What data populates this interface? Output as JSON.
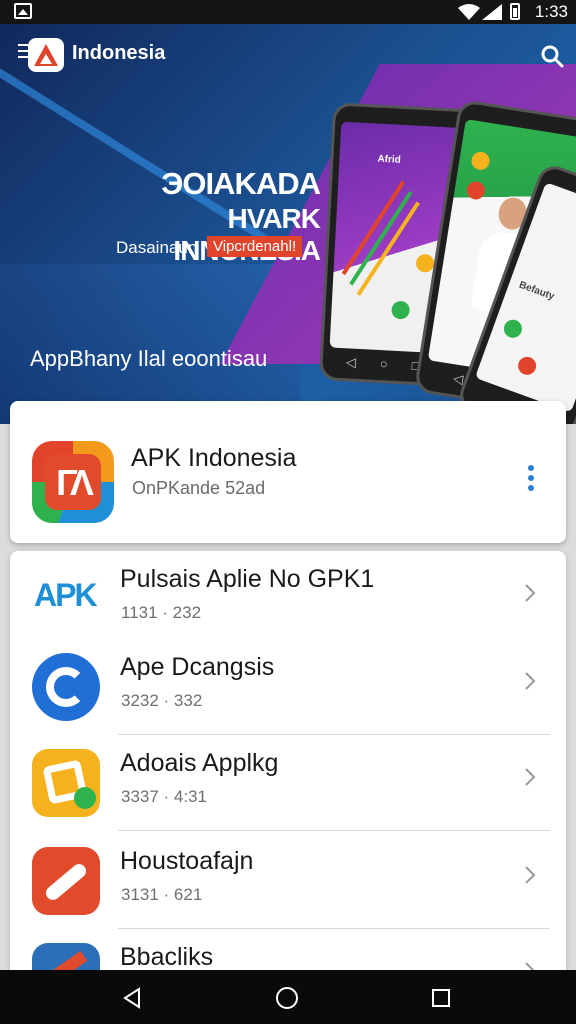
{
  "status": {
    "time": "1:33"
  },
  "header": {
    "title": "Indonesia"
  },
  "banner": {
    "heading_1": "ЭOIAKADA",
    "heading_2": "HVARK INNONESIA",
    "subtitle": "Dasainaun",
    "badge": "Vipcrdenahl!",
    "tagline": "AppBhany Ilal eoontisau",
    "phone_label": "Afrid",
    "phone_card": "Befauty"
  },
  "featured_app": {
    "name": "APK Indonesia",
    "subtitle": "OnPKande 52ad",
    "icon": "apk-indonesia-logo"
  },
  "app_list": [
    {
      "title": "Pulsais Aplie No GPK1",
      "meta": "1131 · 232",
      "icon": "apk-blue-icon"
    },
    {
      "title": "Ape Dcangsis",
      "meta": "3232 · 332",
      "icon": "blue-ring-icon"
    },
    {
      "title": "Adoais Applkg",
      "meta": "3337 · 4:31",
      "icon": "yellow-square-icon"
    },
    {
      "title": "Houstoafajn",
      "meta": "3131 · 621",
      "icon": "red-wrench-icon"
    },
    {
      "title": "Bbacliks",
      "meta": "",
      "icon": "blue-tool-icon"
    }
  ],
  "colors": {
    "accent": "#e0452c",
    "brand_blue": "#1f8fd6",
    "more_dots": "#2b7fd1"
  }
}
